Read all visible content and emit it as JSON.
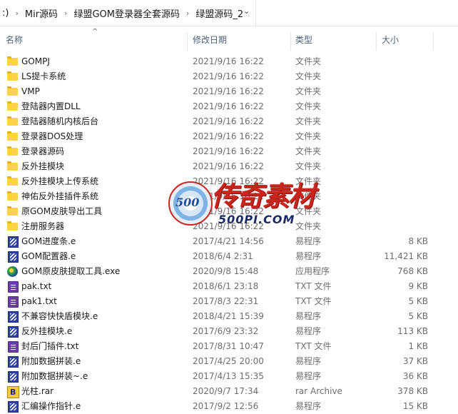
{
  "breadcrumb": {
    "drive_fragment": ":)",
    "items": [
      "Mir源码",
      "绿盟GOM登录器全套源码",
      "绿盟源码_2"
    ]
  },
  "columns": {
    "name": "名称",
    "date": "修改日期",
    "type": "类型",
    "size": "大小"
  },
  "files": [
    {
      "icon": "folder-icon",
      "name": "GOMPJ",
      "date": "2021/9/16 16:22",
      "type": "文件夹",
      "size": ""
    },
    {
      "icon": "folder-icon",
      "name": "LS提卡系统",
      "date": "2021/9/16 16:22",
      "type": "文件夹",
      "size": ""
    },
    {
      "icon": "folder-icon",
      "name": "VMP",
      "date": "2021/9/16 16:22",
      "type": "文件夹",
      "size": ""
    },
    {
      "icon": "folder-icon",
      "name": "登陆器内置DLL",
      "date": "2021/9/16 16:22",
      "type": "文件夹",
      "size": ""
    },
    {
      "icon": "folder-icon",
      "name": "登陆器随机内核后台",
      "date": "2021/9/16 16:22",
      "type": "文件夹",
      "size": ""
    },
    {
      "icon": "folder-icon",
      "name": "登录器DOS处理",
      "date": "2021/9/16 16:22",
      "type": "文件夹",
      "size": ""
    },
    {
      "icon": "folder-icon",
      "name": "登录器源码",
      "date": "2021/9/16 16:22",
      "type": "文件夹",
      "size": ""
    },
    {
      "icon": "folder-icon",
      "name": "反外挂模块",
      "date": "2021/9/16 16:22",
      "type": "文件夹",
      "size": ""
    },
    {
      "icon": "folder-icon",
      "name": "反外挂模块上传系统",
      "date": "2021/9/16 16:22",
      "type": "文件夹",
      "size": ""
    },
    {
      "icon": "folder-icon",
      "name": "神佑反外挂插件系统",
      "date": "2021/9/16 16:22",
      "type": "文件夹",
      "size": ""
    },
    {
      "icon": "folder-icon",
      "name": "原GOM皮肤导出工具",
      "date": "2021/9/16 16:22",
      "type": "文件夹",
      "size": ""
    },
    {
      "icon": "folder-icon",
      "name": "注册服务器",
      "date": "2021/9/16 16:22",
      "type": "文件夹",
      "size": ""
    },
    {
      "icon": "e-file-icon",
      "name": "GOM进度条.e",
      "date": "2017/4/21 14:56",
      "type": "易程序",
      "size": "8 KB"
    },
    {
      "icon": "e-file-icon",
      "name": "GOM配置器.e",
      "date": "2018/6/4 2:31",
      "type": "易程序",
      "size": "11,421 KB"
    },
    {
      "icon": "exe-file-icon",
      "name": "GOM原皮肤提取工具.exe",
      "date": "2020/9/8 15:48",
      "type": "应用程序",
      "size": "768 KB"
    },
    {
      "icon": "txt-file-icon",
      "name": "pak.txt",
      "date": "2018/6/1 23:18",
      "type": "TXT 文件",
      "size": "9 KB"
    },
    {
      "icon": "txt-file-icon",
      "name": "pak1.txt",
      "date": "2017/8/3 22:31",
      "type": "TXT 文件",
      "size": "5 KB"
    },
    {
      "icon": "e-file-icon",
      "name": "不兼容快快盾模块.e",
      "date": "2018/4/21 15:39",
      "type": "易程序",
      "size": "5 KB"
    },
    {
      "icon": "e-file-icon",
      "name": "反外挂模块.e",
      "date": "2017/6/9 23:32",
      "type": "易程序",
      "size": "113 KB"
    },
    {
      "icon": "txt-file-icon",
      "name": "封后门插件.txt",
      "date": "2017/8/31 10:47",
      "type": "TXT 文件",
      "size": "1 KB"
    },
    {
      "icon": "e-file-icon",
      "name": "附加数据拼装.e",
      "date": "2017/4/25 20:00",
      "type": "易程序",
      "size": "37 KB"
    },
    {
      "icon": "e-file-icon",
      "name": "附加数据拼装~.e",
      "date": "2017/4/13 15:35",
      "type": "易程序",
      "size": "36 KB"
    },
    {
      "icon": "rar-file-icon",
      "name": "光柱.rar",
      "date": "2020/9/7 17:34",
      "type": "rar Archive",
      "size": "378 KB"
    },
    {
      "icon": "e-file-icon",
      "name": "汇编操作指针.e",
      "date": "2017/9/2 12:56",
      "type": "易程序",
      "size": "15 KB"
    }
  ],
  "watermark": {
    "logo_text": "500",
    "brand": "传奇素材",
    "domain": "500PI.COM"
  }
}
